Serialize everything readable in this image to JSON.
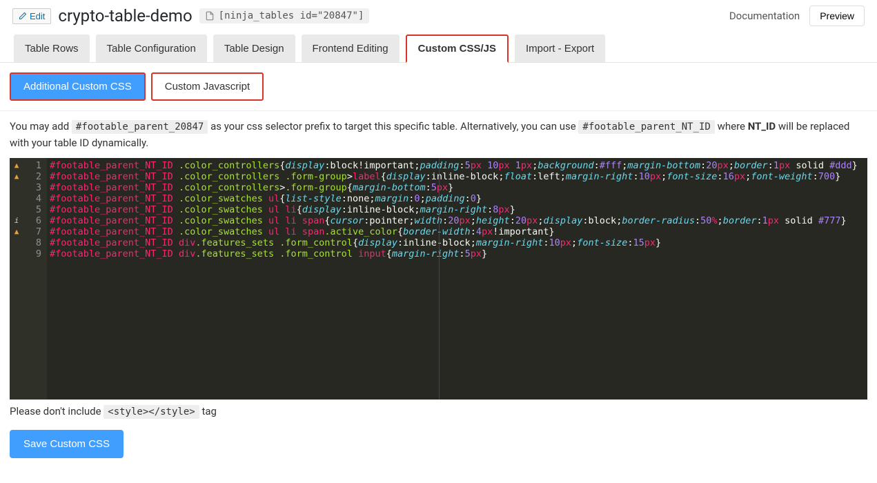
{
  "header": {
    "edit_label": "Edit",
    "title": "crypto-table-demo",
    "shortcode": "[ninja_tables id=\"20847\"]",
    "documentation": "Documentation",
    "preview": "Preview"
  },
  "tabs": [
    {
      "label": "Table Rows",
      "active": false
    },
    {
      "label": "Table Configuration",
      "active": false
    },
    {
      "label": "Table Design",
      "active": false
    },
    {
      "label": "Frontend Editing",
      "active": false
    },
    {
      "label": "Custom CSS/JS",
      "active": true
    },
    {
      "label": "Import - Export",
      "active": false
    }
  ],
  "subtabs": [
    {
      "label": "Additional Custom CSS",
      "active": true
    },
    {
      "label": "Custom Javascript",
      "active": false
    }
  ],
  "info": {
    "prefix_text_1": "You may add ",
    "selector1": "#footable_parent_20847",
    "mid_text": " as your css selector prefix to target this specific table. Alternatively, you can use ",
    "selector2": "#footable_parent_NT_ID",
    "suffix_text_1": " where ",
    "bold": "NT_ID",
    "suffix_text_2": " will be replaced with your table ID dynamically."
  },
  "editor": {
    "lines": [
      {
        "n": 1,
        "icon": "w",
        "raw": "#footable_parent_NT_ID .color_controllers{display:block!important;padding:5px 10px 1px;background:#fff;margin-bottom:20px;border:1px solid #ddd}"
      },
      {
        "n": 2,
        "icon": "w",
        "raw": "#footable_parent_NT_ID .color_controllers .form-group>label{display:inline-block;float:left;margin-right:10px;font-size:16px;font-weight:700}"
      },
      {
        "n": 3,
        "icon": "",
        "raw": "#footable_parent_NT_ID .color_controllers>.form-group{margin-bottom:5px}"
      },
      {
        "n": 4,
        "icon": "",
        "raw": "#footable_parent_NT_ID .color_swatches ul{list-style:none;margin:0;padding:0}"
      },
      {
        "n": 5,
        "icon": "",
        "raw": "#footable_parent_NT_ID .color_swatches ul li{display:inline-block;margin-right:8px}"
      },
      {
        "n": 6,
        "icon": "i",
        "raw": "#footable_parent_NT_ID .color_swatches ul li span{cursor:pointer;width:20px;height:20px;display:block;border-radius:50%;border:1px solid #777}"
      },
      {
        "n": 7,
        "icon": "w",
        "raw": "#footable_parent_NT_ID .color_swatches ul li span.active_color{border-width:4px!important}"
      },
      {
        "n": 8,
        "icon": "",
        "raw": "#footable_parent_NT_ID div.features_sets .form_control{display:inline-block;margin-right:10px;font-size:15px}"
      },
      {
        "n": 9,
        "icon": "",
        "raw": "#footable_parent_NT_ID div.features_sets .form_control input{margin-right:5px}"
      }
    ]
  },
  "below": {
    "text_1": "Please don't include ",
    "code": "<style></style>",
    "text_2": " tag"
  },
  "save_button": "Save Custom CSS"
}
